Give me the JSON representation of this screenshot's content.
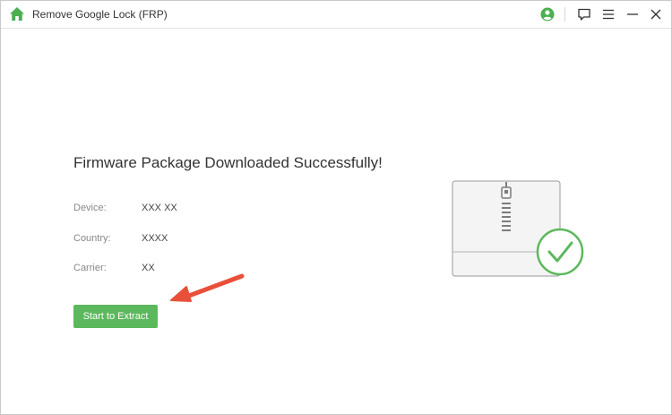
{
  "window": {
    "title": "Remove Google Lock (FRP)"
  },
  "toolbar": {
    "icons": [
      "home-icon",
      "account-icon",
      "feedback-icon",
      "menu-icon",
      "minimize-icon",
      "close-icon"
    ]
  },
  "main": {
    "heading": "Firmware Package Downloaded Successfully!",
    "info": [
      {
        "label": "Device:",
        "value": "XXX XX"
      },
      {
        "label": "Country:",
        "value": "XXXX"
      },
      {
        "label": "Carrier:",
        "value": "XX"
      }
    ],
    "extract_label": "Start to Extract"
  },
  "colors": {
    "accent_green": "#5cb85c",
    "arrow_red": "#e8503a"
  }
}
